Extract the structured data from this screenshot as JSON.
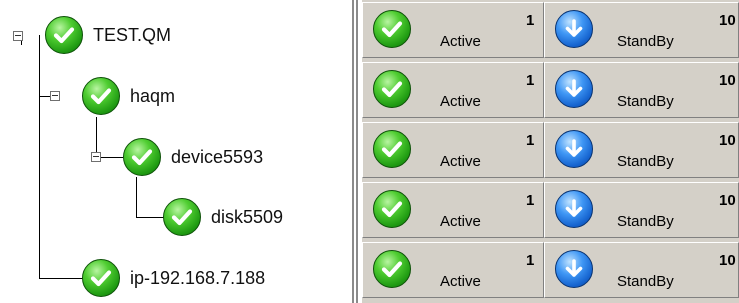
{
  "tree": {
    "nodes": [
      {
        "label": "TEST.QM",
        "status_icon": "check-icon",
        "expanded": true
      },
      {
        "label": "haqm",
        "status_icon": "check-icon",
        "expanded": true
      },
      {
        "label": "device5593",
        "status_icon": "check-icon",
        "expanded": true
      },
      {
        "label": "disk5509",
        "status_icon": "check-icon"
      },
      {
        "label": "ip-192.168.7.188",
        "status_icon": "check-icon"
      }
    ]
  },
  "grid": {
    "rows": [
      {
        "active": {
          "label": "Active",
          "count": "1",
          "icon": "check-icon"
        },
        "standby": {
          "label": "StandBy",
          "count": "10",
          "icon": "down-arrow-icon"
        }
      },
      {
        "active": {
          "label": "Active",
          "count": "1",
          "icon": "check-icon"
        },
        "standby": {
          "label": "StandBy",
          "count": "10",
          "icon": "down-arrow-icon"
        }
      },
      {
        "active": {
          "label": "Active",
          "count": "1",
          "icon": "check-icon"
        },
        "standby": {
          "label": "StandBy",
          "count": "10",
          "icon": "down-arrow-icon"
        }
      },
      {
        "active": {
          "label": "Active",
          "count": "1",
          "icon": "check-icon"
        },
        "standby": {
          "label": "StandBy",
          "count": "10",
          "icon": "down-arrow-icon"
        }
      },
      {
        "active": {
          "label": "Active",
          "count": "1",
          "icon": "check-icon"
        },
        "standby": {
          "label": "StandBy",
          "count": "10",
          "icon": "down-arrow-icon"
        }
      }
    ]
  },
  "colors": {
    "check_green": "#2eae1c",
    "arrow_blue": "#1f6fe0",
    "panel_gray": "#d4d0c8"
  }
}
